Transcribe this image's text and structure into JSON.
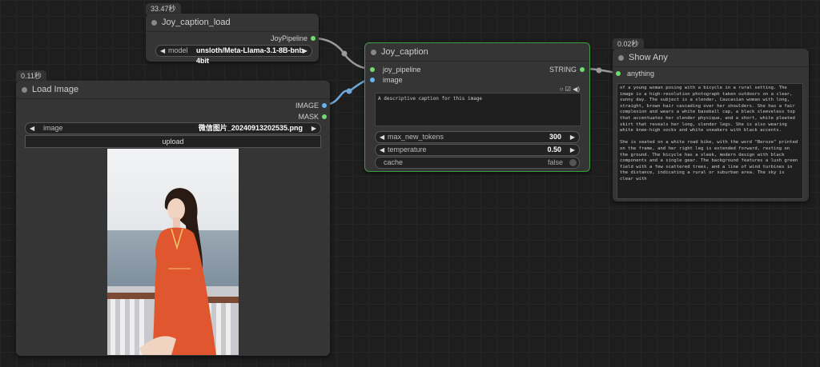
{
  "timings": {
    "joy_caption_load": "33.47秒",
    "load_image": "0.11秒",
    "show_any": "0.02秒"
  },
  "colors": {
    "link_pipeline": "#9a9a9a",
    "link_image": "#6fa8dc",
    "node_selected_border": "#3c9e3c",
    "port_green": "#6fdc6f",
    "port_blue": "#64b5f6"
  },
  "joy_caption_load": {
    "title": "Joy_caption_load",
    "output": "JoyPipeline",
    "model_label": "model",
    "model_value": "unsloth/Meta-Llama-3.1-8B-bnb-4bit"
  },
  "load_image": {
    "title": "Load Image",
    "output_image": "IMAGE",
    "output_mask": "MASK",
    "image_label": "image",
    "image_value": "微信图片_20240913202535.png",
    "upload_label": "upload"
  },
  "joy_caption": {
    "title": "Joy_caption",
    "input_pipeline": "joy_pipeline",
    "input_image": "image",
    "output": "STRING",
    "prompt": "A descriptive caption for this image",
    "max_new_tokens_label": "max_new_tokens",
    "max_new_tokens_value": "300",
    "temperature_label": "temperature",
    "temperature_value": "0.50",
    "cache_label": "cache",
    "cache_value": "false"
  },
  "show_any": {
    "title": "Show Any",
    "input": "anything",
    "text": "of a young woman posing with a bicycle in a rural setting. The image is a high-resolution photograph taken outdoors on a clear, sunny day. The subject is a slender, Caucasian woman with long, straight, brown hair cascading over her shoulders. She has a fair complexion and wears a white baseball cap, a black sleeveless top that accentuates her slender physique, and a short, white pleated skirt that reveals her long, slender legs. She is also wearing white knee-high socks and white sneakers with black accents.\n\nShe is seated on a white road bike, with the word \"Beroze\" printed on the frame, and her right leg is extended forward, resting on the ground. The bicycle has a sleek, modern design with black components and a single gear. The background features a lush green field with a few scattered trees, and a line of wind turbines in the distance, indicating a rural or suburban area. The sky is clear with"
  }
}
